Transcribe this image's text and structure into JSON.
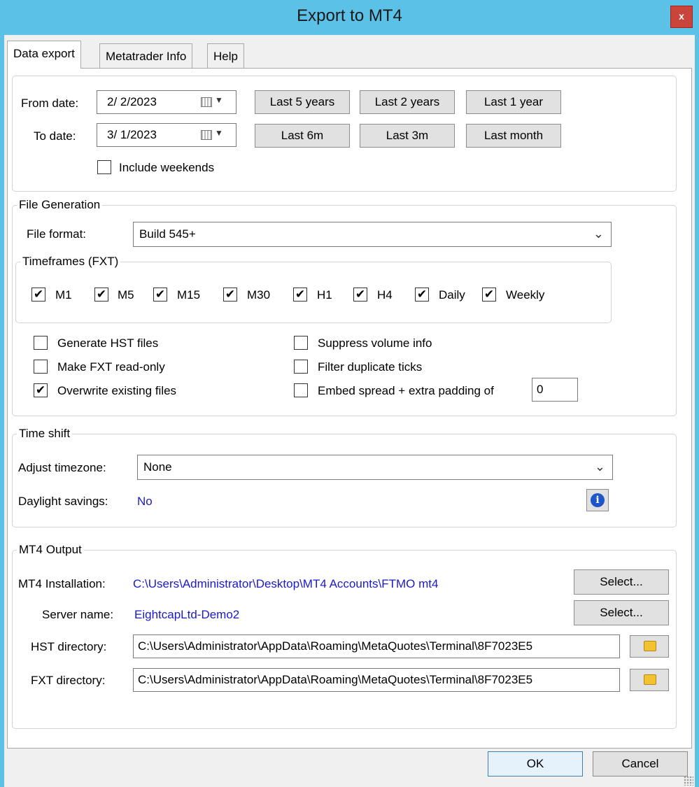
{
  "window": {
    "title": "Export to MT4",
    "close_label": "x"
  },
  "tabs": [
    {
      "label": "Data export",
      "active": true
    },
    {
      "label": "Metatrader Info",
      "active": false
    },
    {
      "label": "Help",
      "active": false
    }
  ],
  "dates": {
    "from_label": "From date:",
    "from_value": "2/ 2/2023",
    "to_label": "To date:",
    "to_value": "3/ 1/2023",
    "include_weekends_label": "Include weekends",
    "include_weekends_checked": false,
    "quick_buttons": [
      "Last 5 years",
      "Last 2 years",
      "Last 1 year",
      "Last 6m",
      "Last 3m",
      "Last month"
    ]
  },
  "file_generation": {
    "legend": "File Generation",
    "format_label": "File format:",
    "format_value": "Build 545+",
    "timeframes_legend": "Timeframes (FXT)",
    "timeframes": [
      {
        "label": "M1",
        "checked": true
      },
      {
        "label": "M5",
        "checked": true
      },
      {
        "label": "M15",
        "checked": true
      },
      {
        "label": "M30",
        "checked": true
      },
      {
        "label": "H1",
        "checked": true
      },
      {
        "label": "H4",
        "checked": true
      },
      {
        "label": "Daily",
        "checked": true
      },
      {
        "label": "Weekly",
        "checked": true
      }
    ],
    "options_left": [
      {
        "label": "Generate HST files",
        "checked": false
      },
      {
        "label": "Make FXT read-only",
        "checked": false
      },
      {
        "label": "Overwrite existing files",
        "checked": true
      }
    ],
    "options_right": [
      {
        "label": "Suppress volume info",
        "checked": false
      },
      {
        "label": "Filter duplicate ticks",
        "checked": false
      },
      {
        "label": "Embed spread + extra padding of",
        "checked": false
      }
    ],
    "padding_value": "0"
  },
  "time_shift": {
    "legend": "Time shift",
    "timezone_label": "Adjust timezone:",
    "timezone_value": "None",
    "dst_label": "Daylight savings:",
    "dst_value": "No"
  },
  "output": {
    "legend": "MT4 Output",
    "installation_label": "MT4 Installation:",
    "installation_value": "C:\\Users\\Administrator\\Desktop\\MT4 Accounts\\FTMO mt4",
    "server_label": "Server name:",
    "server_value": "EightcapLtd-Demo2",
    "select_label": "Select...",
    "hst_label": "HST directory:",
    "hst_value": "C:\\Users\\Administrator\\AppData\\Roaming\\MetaQuotes\\Terminal\\8F7023E5",
    "fxt_label": "FXT directory:",
    "fxt_value": "C:\\Users\\Administrator\\AppData\\Roaming\\MetaQuotes\\Terminal\\8F7023E5"
  },
  "footer": {
    "ok_label": "OK",
    "cancel_label": "Cancel"
  },
  "icons": {
    "calendar": "calendar-icon",
    "dropdown": "chevron-down-icon",
    "info": "info-icon",
    "folder": "folder-icon",
    "check_glyph": "✔"
  }
}
